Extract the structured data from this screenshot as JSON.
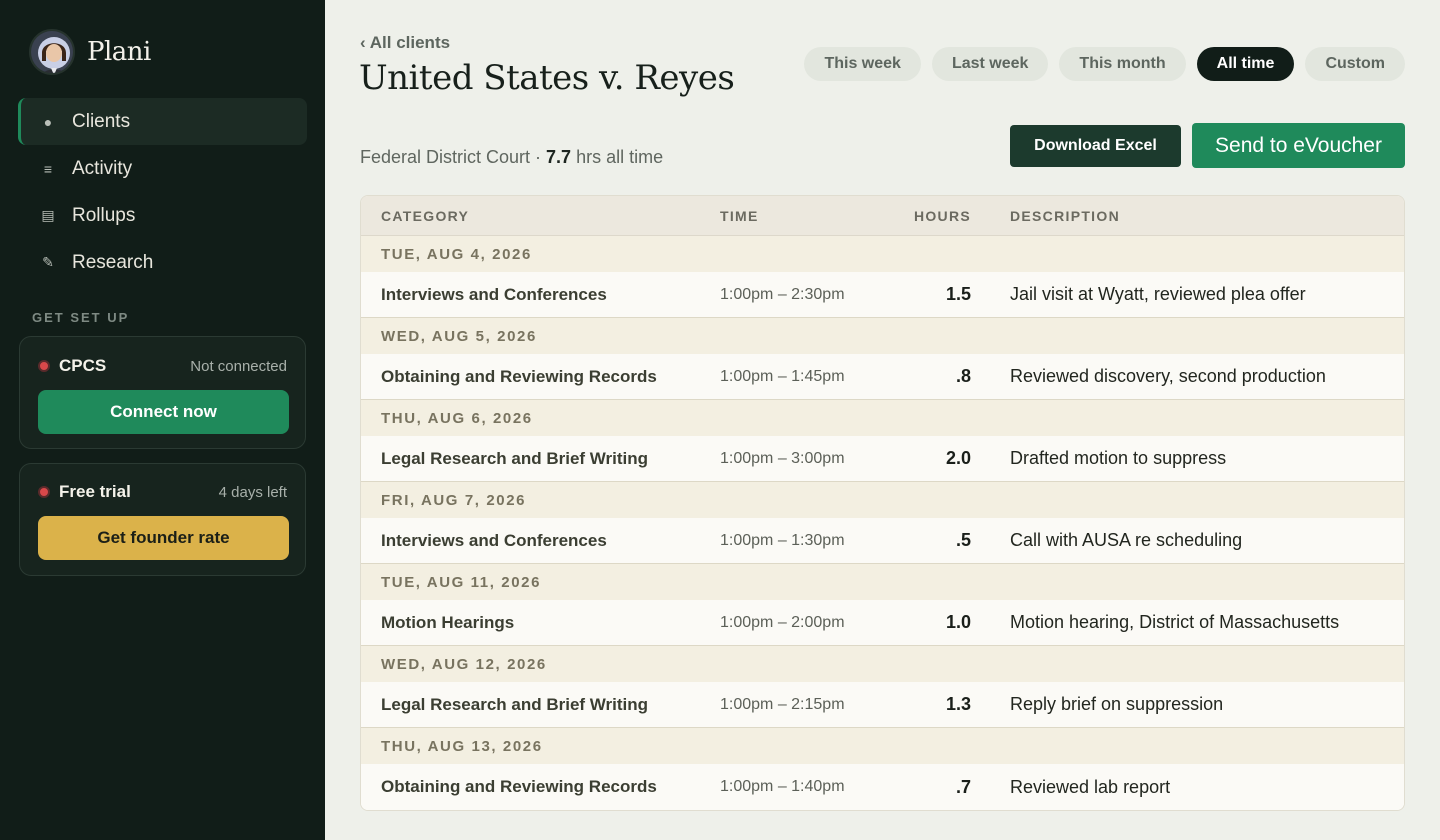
{
  "app": {
    "name": "Plani"
  },
  "sidebar": {
    "items": [
      {
        "label": "Clients",
        "icon": "●"
      },
      {
        "label": "Activity",
        "icon": "≡"
      },
      {
        "label": "Rollups",
        "icon": "▤"
      },
      {
        "label": "Research",
        "icon": "✎"
      }
    ],
    "setup_title": "GET SET UP",
    "cpcs": {
      "label": "CPCS",
      "status": "Not connected",
      "button": "Connect now"
    },
    "trial": {
      "label": "Free trial",
      "status": "4 days left",
      "button": "Get founder rate"
    }
  },
  "header": {
    "back": "‹ All clients",
    "title": "United States v. Reyes",
    "court": "Federal District Court · ",
    "hours": "7.7",
    "hours_suffix": " hrs all time"
  },
  "filters": [
    "This week",
    "Last week",
    "This month",
    "All time",
    "Custom"
  ],
  "actions": {
    "download": "Download Excel",
    "evoucher": "Send to eVoucher"
  },
  "table": {
    "headers": {
      "category": "CATEGORY",
      "time": "TIME",
      "hours": "HOURS",
      "description": "DESCRIPTION"
    },
    "groups": [
      {
        "date": "TUE, AUG 4, 2026",
        "category": "Interviews and Conferences",
        "time": "1:00pm – 2:30pm",
        "hours": "1.5",
        "description": "Jail visit at Wyatt, reviewed plea offer"
      },
      {
        "date": "WED, AUG 5, 2026",
        "category": "Obtaining and Reviewing Records",
        "time": "1:00pm – 1:45pm",
        "hours": ".8",
        "description": "Reviewed discovery, second production"
      },
      {
        "date": "THU, AUG 6, 2026",
        "category": "Legal Research and Brief Writing",
        "time": "1:00pm – 3:00pm",
        "hours": "2.0",
        "description": "Drafted motion to suppress"
      },
      {
        "date": "FRI, AUG 7, 2026",
        "category": "Interviews and Conferences",
        "time": "1:00pm – 1:30pm",
        "hours": ".5",
        "description": "Call with AUSA re scheduling"
      },
      {
        "date": "TUE, AUG 11, 2026",
        "category": "Motion Hearings",
        "time": "1:00pm – 2:00pm",
        "hours": "1.0",
        "description": "Motion hearing, District of Massachusetts"
      },
      {
        "date": "WED, AUG 12, 2026",
        "category": "Legal Research and Brief Writing",
        "time": "1:00pm – 2:15pm",
        "hours": "1.3",
        "description": "Reply brief on suppression"
      },
      {
        "date": "THU, AUG 13, 2026",
        "category": "Obtaining and Reviewing Records",
        "time": "1:00pm – 1:40pm",
        "hours": ".7",
        "description": "Reviewed lab report"
      }
    ]
  }
}
